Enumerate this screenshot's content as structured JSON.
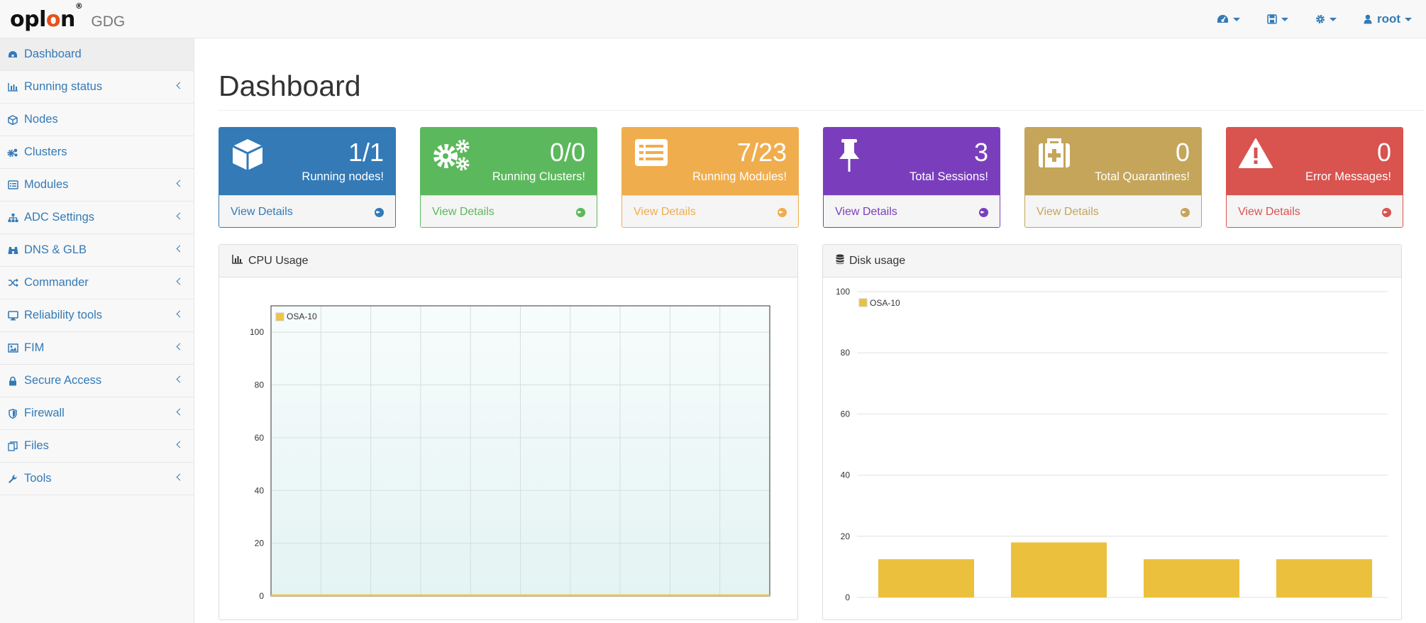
{
  "navbar": {
    "brand_logo_parts": [
      "opl",
      "o",
      "n"
    ],
    "brand_app": "GDG",
    "user_label": "root",
    "menus": [
      "dashboard-icon",
      "save-icon",
      "gear-icon",
      "user-icon"
    ]
  },
  "sidebar": {
    "items": [
      {
        "label": "Dashboard",
        "icon": "dashboard-icon",
        "active": true,
        "expandable": false
      },
      {
        "label": "Running status",
        "icon": "bar-chart-icon",
        "active": false,
        "expandable": true
      },
      {
        "label": "Nodes",
        "icon": "cube-icon",
        "active": false,
        "expandable": false
      },
      {
        "label": "Clusters",
        "icon": "gears-icon",
        "active": false,
        "expandable": false
      },
      {
        "label": "Modules",
        "icon": "list-icon",
        "active": false,
        "expandable": true
      },
      {
        "label": "ADC Settings",
        "icon": "sitemap-icon",
        "active": false,
        "expandable": true
      },
      {
        "label": "DNS & GLB",
        "icon": "binoculars-icon",
        "active": false,
        "expandable": true
      },
      {
        "label": "Commander",
        "icon": "random-icon",
        "active": false,
        "expandable": true
      },
      {
        "label": "Reliability tools",
        "icon": "desktop-icon",
        "active": false,
        "expandable": true
      },
      {
        "label": "FIM",
        "icon": "image-icon",
        "active": false,
        "expandable": true
      },
      {
        "label": "Secure Access",
        "icon": "lock-icon",
        "active": false,
        "expandable": true
      },
      {
        "label": "Firewall",
        "icon": "shield-icon",
        "active": false,
        "expandable": true
      },
      {
        "label": "Files",
        "icon": "files-icon",
        "active": false,
        "expandable": true
      },
      {
        "label": "Tools",
        "icon": "wrench-icon",
        "active": false,
        "expandable": true
      }
    ]
  },
  "page": {
    "title": "Dashboard"
  },
  "panels": [
    {
      "value": "1/1",
      "label": "Running nodes!",
      "link": "View Details",
      "icon": "cube-icon",
      "color": "#337ab7"
    },
    {
      "value": "0/0",
      "label": "Running Clusters!",
      "link": "View Details",
      "icon": "gears-icon",
      "color": "#5cb85c"
    },
    {
      "value": "7/23",
      "label": "Running Modules!",
      "link": "View Details",
      "icon": "list-icon",
      "color": "#f0ad4e"
    },
    {
      "value": "3",
      "label": "Total Sessions!",
      "link": "View Details",
      "icon": "pin-icon",
      "color": "#7a3ebd"
    },
    {
      "value": "0",
      "label": "Total Quarantines!",
      "link": "View Details",
      "icon": "medkit-icon",
      "color": "#c4a55a"
    },
    {
      "value": "0",
      "label": "Error Messages!",
      "link": "View Details",
      "icon": "warning-icon",
      "color": "#d9534f"
    }
  ],
  "cpu_panel": {
    "title": "CPU Usage",
    "icon": "bar-chart-icon"
  },
  "disk_panel": {
    "title": "Disk usage",
    "icon": "database-icon"
  },
  "chart_data": [
    {
      "type": "line",
      "series": [
        {
          "name": "OSA-10",
          "values": [
            0,
            0,
            0,
            0,
            0,
            0,
            0,
            0,
            0,
            0,
            0
          ],
          "color": "#f0c43c"
        }
      ],
      "x_count": 11,
      "ylim": [
        0,
        110
      ],
      "yticks": [
        "0",
        "20",
        "40",
        "60",
        "80",
        "100"
      ],
      "grid": true,
      "legend": "top-left"
    },
    {
      "type": "bar",
      "series": [
        {
          "name": "OSA-10",
          "values": [
            12.5,
            18,
            12.5,
            12.5
          ],
          "color": "#ebc03c"
        }
      ],
      "ylim": [
        0,
        100
      ],
      "yticks": [
        "0",
        "20",
        "40",
        "60",
        "80",
        "100"
      ],
      "grid": true,
      "legend": "top-left"
    }
  ]
}
